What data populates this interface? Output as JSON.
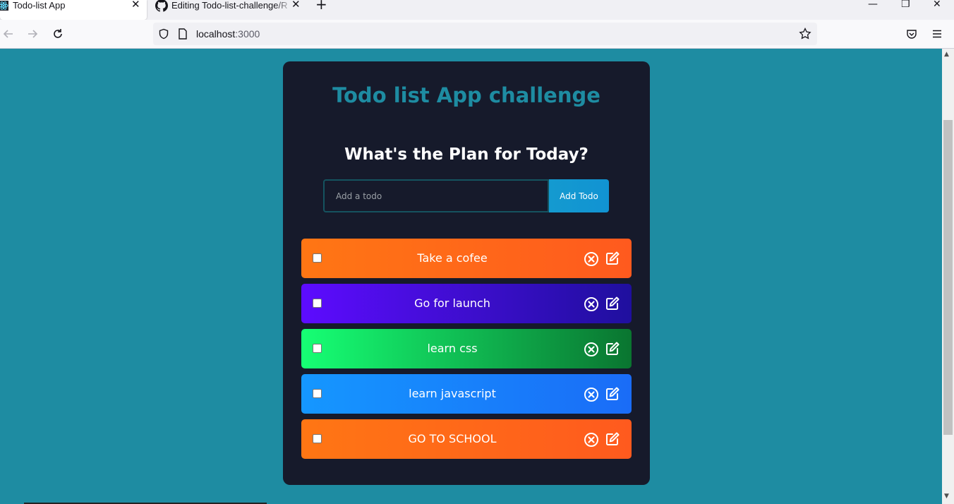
{
  "browser": {
    "tabs": [
      {
        "title": "Todo-list App",
        "active": true,
        "icon": "react-icon"
      },
      {
        "title": "Editing Todo-list-challenge/R",
        "active": false,
        "icon": "github-icon"
      }
    ],
    "url_host": "localhost",
    "url_port": ":3000"
  },
  "app": {
    "title": "Todo list App challenge",
    "subtitle": "What's the Plan for Today?",
    "input_placeholder": "Add a todo",
    "input_value": "",
    "add_button_label": "Add Todo",
    "colors": {
      "page_background": "#1e8ca2",
      "card_background": "#161a2b",
      "title_color": "#1e8ca2"
    }
  },
  "todos": [
    {
      "text": "Take a cofee",
      "checked": false,
      "gradient": [
        "#ff7614",
        "#ff5a1e"
      ]
    },
    {
      "text": "Go for launch",
      "checked": false,
      "gradient": [
        "#5d0cff",
        "#1f0f9e"
      ]
    },
    {
      "text": "learn css",
      "checked": false,
      "gradient": [
        "#16ff74",
        "#0a7530"
      ]
    },
    {
      "text": "learn javascript",
      "checked": false,
      "gradient": [
        "#1597ff",
        "#1a6cf7"
      ]
    },
    {
      "text": "GO TO SCHOOL",
      "checked": false,
      "gradient": [
        "#ff7614",
        "#ff5a1e"
      ]
    }
  ]
}
